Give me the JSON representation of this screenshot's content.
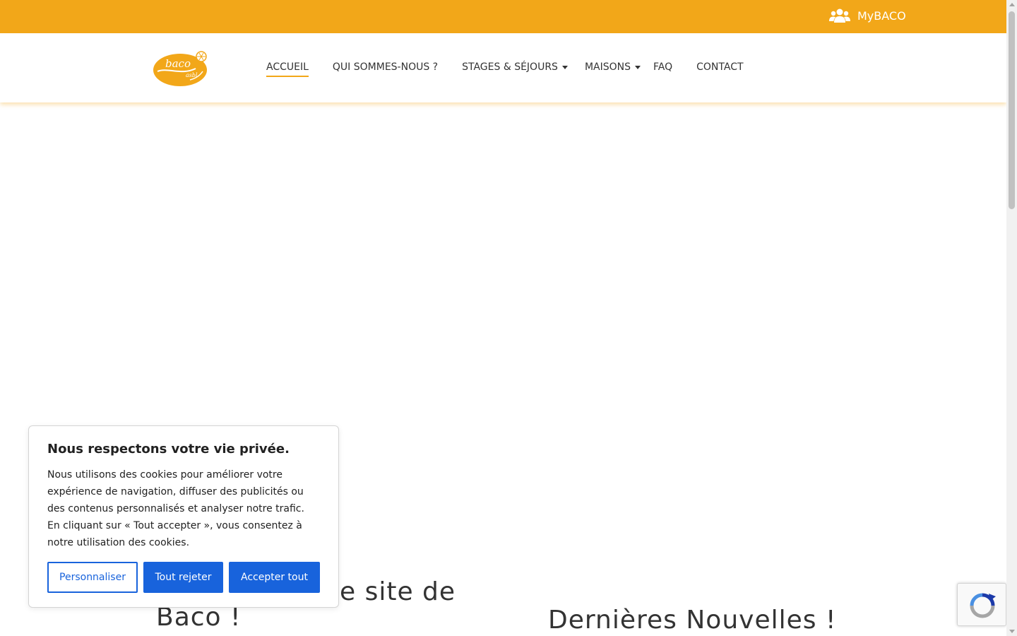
{
  "topbar": {
    "account_label": "MyBACO",
    "account_icon": "users-icon",
    "color": "#f2a719"
  },
  "header": {
    "logo_text": "baco",
    "logo_sub": "asbl",
    "nav": [
      {
        "label": "ACCUEIL",
        "active": true
      },
      {
        "label": "QUI SOMMES-NOUS ?"
      },
      {
        "label": "STAGES & SÉJOURS",
        "dropdown": true
      },
      {
        "label": "MAISONS",
        "dropdown": true
      },
      {
        "label": "FAQ"
      },
      {
        "label": "CONTACT"
      }
    ]
  },
  "main": {
    "heading_left_line1": "e site de",
    "heading_left_line2": "Baco !",
    "heading_right": "Dernières Nouvelles !"
  },
  "cookie": {
    "title": "Nous respectons votre vie privée.",
    "text": "Nous utilisons des cookies pour améliorer votre expérience de navigation, diffuser des publicités ou des contenus personnalisés et analyser notre trafic. En cliquant sur « Tout accepter », vous consentez à notre utilisation des cookies.",
    "customize_label": "Personnaliser",
    "reject_label": "Tout rejeter",
    "accept_label": "Accepter tout",
    "button_color": "#1863dc"
  }
}
